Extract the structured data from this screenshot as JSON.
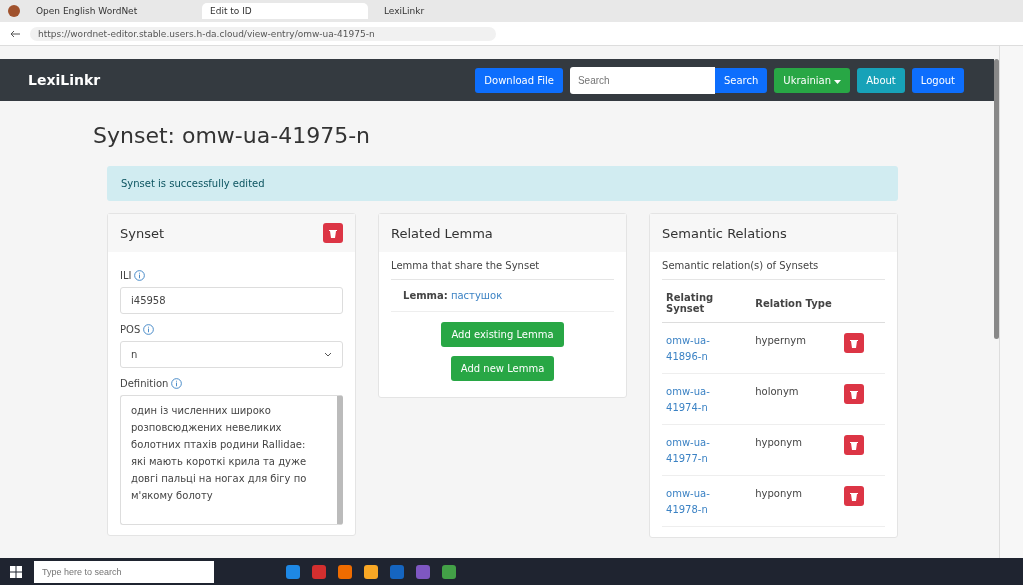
{
  "browser": {
    "tabs": [
      {
        "title": "Open English WordNet",
        "selected": false
      },
      {
        "title": "Edit to ID",
        "selected": true
      },
      {
        "title": "LexiLinkr",
        "selected": false
      }
    ],
    "address": "https://wordnet-editor.stable.users.h-da.cloud/view-entry/omw-ua-41975-n"
  },
  "navbar": {
    "brand": "LexiLinkr",
    "download": "Download File",
    "search": {
      "placeholder": "Search"
    },
    "search_button": "Search",
    "language": "Ukrainian",
    "about": "About",
    "logout": "Logout"
  },
  "title": "Synset: omw-ua-41975-n",
  "alert": "Synset is successfully edited",
  "synset_card": {
    "title": "Synset",
    "ili_label": "ILI",
    "ili": "i45958",
    "pos_label": "POS",
    "pos": "n",
    "definition_label": "Definition",
    "definition": "один із численних широко розповсюджених невеликих болотних птахів родини Rallidae: які мають короткі крила та дуже довгі пальці на ногах для бігу по м'якому болоту"
  },
  "lemma_card": {
    "title": "Related Lemma",
    "subtitle": "Lemma that share the Synset",
    "lemma_label": "Lemma:",
    "lemma": "пастушок",
    "buttons": [
      "Add existing Lemma",
      "Add new Lemma"
    ]
  },
  "relations_card": {
    "title": "Semantic Relations",
    "subtitle": "Semantic relation(s) of Synsets",
    "columns": [
      "Relating Synset",
      "Relation Type"
    ],
    "rows": [
      {
        "synset": "omw-ua-41896-n",
        "type": "hypernym"
      },
      {
        "synset": "omw-ua-41974-n",
        "type": "holonym"
      },
      {
        "synset": "omw-ua-41977-n",
        "type": "hyponym"
      },
      {
        "synset": "omw-ua-41978-n",
        "type": "hyponym"
      }
    ]
  },
  "taskbar": {
    "search": {
      "placeholder": "Type here to search"
    }
  }
}
